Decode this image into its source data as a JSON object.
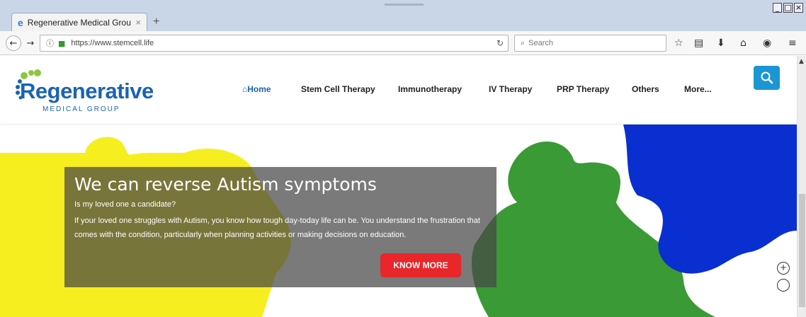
{
  "browser": {
    "tab_title": "Regenerative Medical Group",
    "tab_close": "×",
    "new_tab": "+",
    "url": "https://www.stemcell.life",
    "search_placeholder": "Search",
    "window_controls": [
      "_",
      "□",
      "×"
    ]
  },
  "site": {
    "logo_word": "Regenerative",
    "logo_sub": "MEDICAL GROUP",
    "nav": {
      "home": "Home",
      "stem_cell": "Stem Cell Therapy",
      "immuno": "Immunotherapy",
      "iv": "IV Therapy",
      "prp": "PRP Therapy",
      "others": "Others",
      "more": "More..."
    }
  },
  "hero": {
    "heading": "We can reverse Autism symptoms",
    "question": "Is my loved one a candidate?",
    "paragraph": "If your loved one struggles with Autism, you know how tough day-today life can be. You understand the frustration that comes with the condition, particularly when planning activities or making decisions on education.",
    "button": "KNOW MORE",
    "slider_plus": "+"
  },
  "colors": {
    "brand_blue": "#1a63b4",
    "search_button": "#1c96d2",
    "cta_red": "#e9262a",
    "puzzle_yellow": "#f6ee1e",
    "puzzle_green": "#3a9a35",
    "puzzle_blue": "#0a2fd0"
  },
  "icons": [
    "back-icon",
    "forward-icon",
    "info-icon",
    "lock-icon",
    "reload-icon",
    "search-icon",
    "star-icon",
    "reader-icon",
    "download-icon",
    "home-icon",
    "pocket-icon",
    "menu-icon"
  ]
}
